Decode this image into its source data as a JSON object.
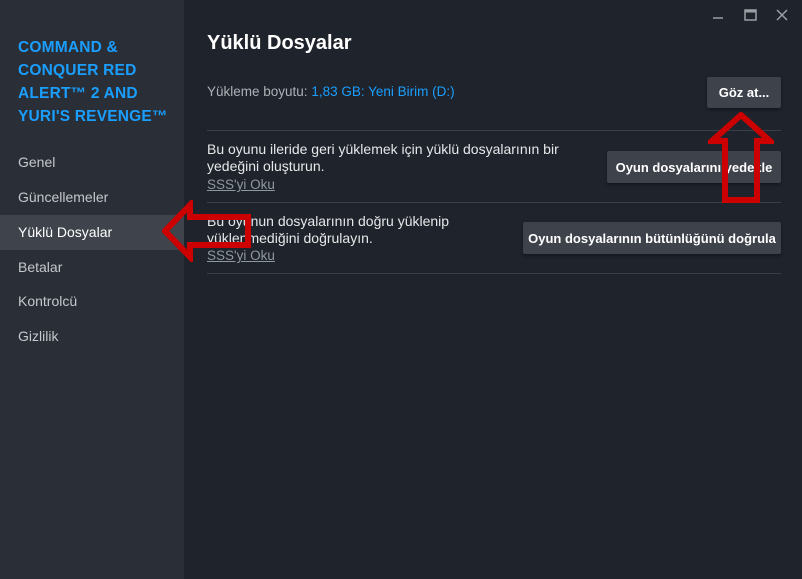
{
  "sidebar": {
    "game_title": "COMMAND & CONQUER RED ALERT™ 2 AND YURI'S REVENGE™",
    "items": [
      {
        "label": "Genel"
      },
      {
        "label": "Güncellemeler"
      },
      {
        "label": "Yüklü Dosyalar",
        "active": true
      },
      {
        "label": "Betalar"
      },
      {
        "label": "Kontrolcü"
      },
      {
        "label": "Gizlilik"
      }
    ]
  },
  "window": {
    "controls": [
      "minimize-icon",
      "maximize-icon",
      "close-icon"
    ]
  },
  "main": {
    "title": "Yüklü Dosyalar",
    "install_size_label": "Yükleme boyutu:",
    "install_size_value": "1,83 GB: Yeni Birim (D:)",
    "browse_button": "Göz at...",
    "backup": {
      "description": "Bu oyunu ileride geri yüklemek için yüklü dosyalarının bir yedeğini oluşturun.",
      "faq_link": "SSS'yi Oku",
      "button": "Oyun dosyalarını yedekle"
    },
    "verify": {
      "description": "Bu oyunun dosyalarının doğru yüklenip yüklenmediğini doğrulayın.",
      "faq_link": "SSS'yi Oku",
      "button": "Oyun dosyalarının bütünlüğünü doğrula"
    }
  },
  "annotations": [
    {
      "icon": "red-arrow-left-icon",
      "color": "#cc0000"
    },
    {
      "icon": "red-arrow-up-icon",
      "color": "#cc0000"
    }
  ],
  "colors": {
    "accent": "#1a9fff",
    "sidebar_bg": "#2a2e36",
    "main_bg": "#1f232b",
    "button_bg": "#3d424b"
  }
}
